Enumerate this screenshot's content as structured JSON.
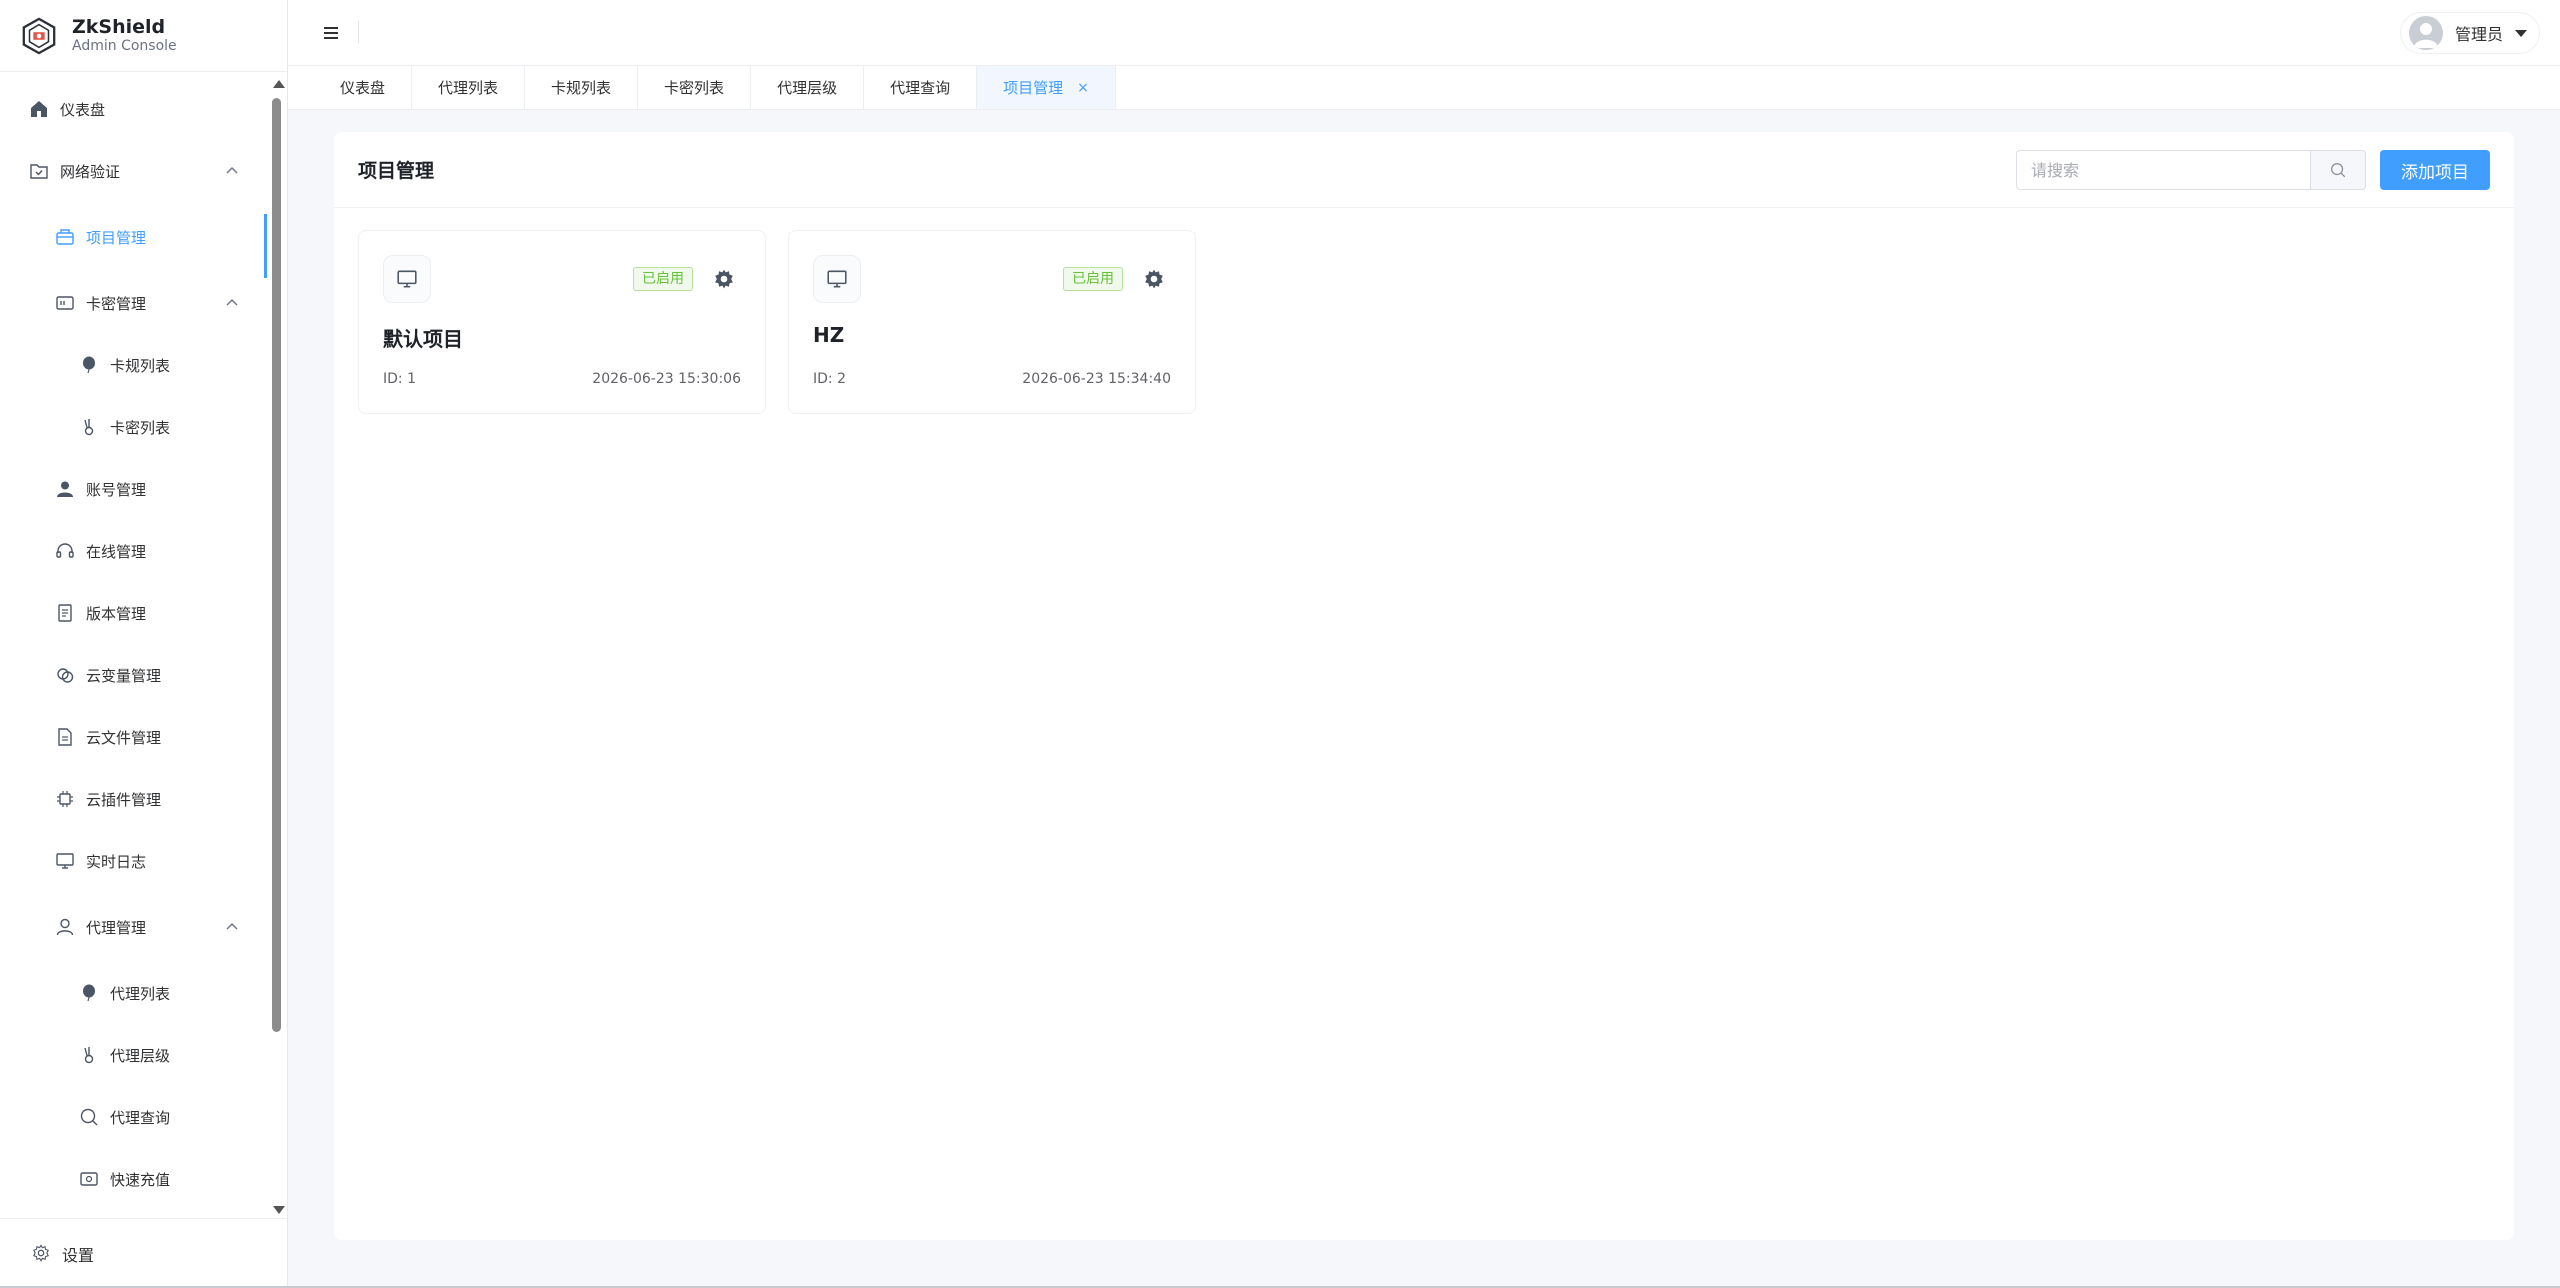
{
  "brand": {
    "title": "ZkShield",
    "subtitle": "Admin Console"
  },
  "sidebar": {
    "items": [
      {
        "label": "仪表盘",
        "icon": "home-icon"
      },
      {
        "label": "网络验证",
        "icon": "folder-check-icon"
      },
      {
        "label": "项目管理",
        "icon": "briefcase-icon"
      },
      {
        "label": "卡密管理",
        "icon": "card-icon"
      },
      {
        "label": "卡规列表",
        "icon": "balloon-icon"
      },
      {
        "label": "卡密列表",
        "icon": "key-icon"
      },
      {
        "label": "账号管理",
        "icon": "user-icon"
      },
      {
        "label": "在线管理",
        "icon": "headset-icon"
      },
      {
        "label": "版本管理",
        "icon": "document-icon"
      },
      {
        "label": "云变量管理",
        "icon": "link-icon"
      },
      {
        "label": "云文件管理",
        "icon": "file-icon"
      },
      {
        "label": "云插件管理",
        "icon": "chip-icon"
      },
      {
        "label": "实时日志",
        "icon": "monitor-icon"
      },
      {
        "label": "代理管理",
        "icon": "user-outline-icon"
      },
      {
        "label": "代理列表",
        "icon": "balloon-icon"
      },
      {
        "label": "代理层级",
        "icon": "key-icon"
      },
      {
        "label": "代理查询",
        "icon": "search-icon"
      },
      {
        "label": "快速充值",
        "icon": "recharge-icon"
      }
    ],
    "footer_label": "设置"
  },
  "header": {
    "user_name": "管理员"
  },
  "tabs": [
    {
      "label": "仪表盘"
    },
    {
      "label": "代理列表"
    },
    {
      "label": "卡规列表"
    },
    {
      "label": "卡密列表"
    },
    {
      "label": "代理层级"
    },
    {
      "label": "代理查询"
    },
    {
      "label": "项目管理",
      "close": "×"
    }
  ],
  "panel": {
    "title": "项目管理",
    "search_placeholder": "请搜索",
    "add_label": "添加项目"
  },
  "projects": [
    {
      "name": "默认项目",
      "status": "已启用",
      "id": "ID: 1",
      "time": "2026-06-23 15:30:06"
    },
    {
      "name": "HZ",
      "status": "已启用",
      "id": "ID: 2",
      "time": "2026-06-23 15:34:40"
    }
  ],
  "colors": {
    "accent": "#409eff",
    "success": "#67c23a",
    "background": "#f5f7fa"
  }
}
